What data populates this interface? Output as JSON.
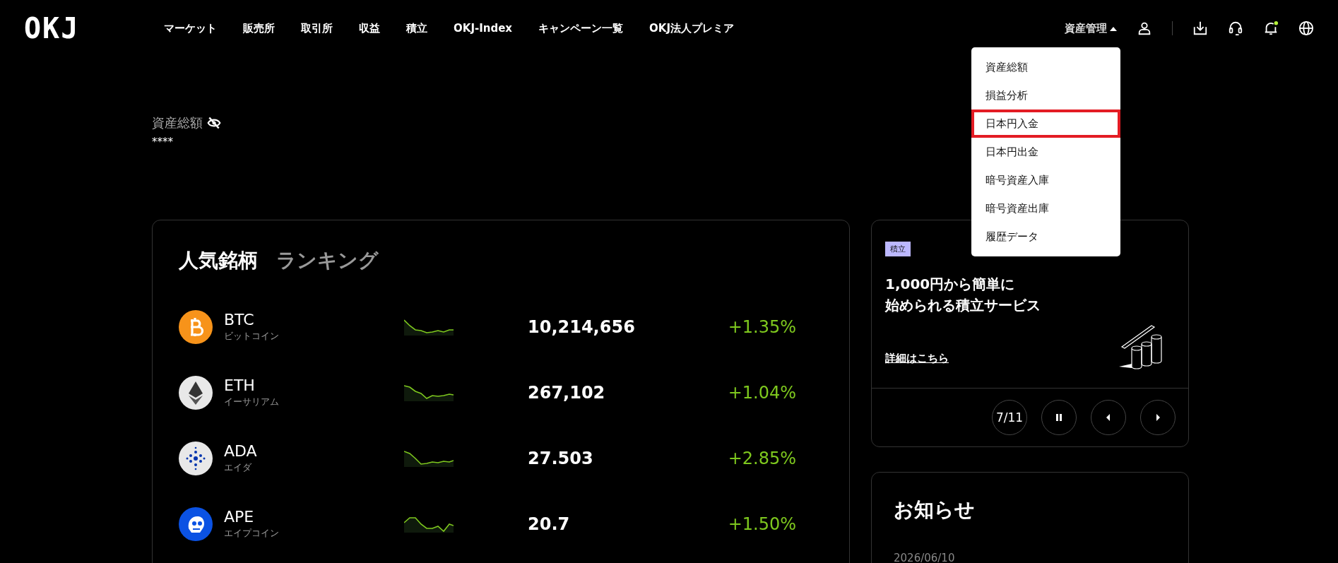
{
  "header": {
    "logo": "OKJ",
    "nav": [
      "マーケット",
      "販売所",
      "取引所",
      "収益",
      "積立",
      "OKJ-Index",
      "キャンペーン一覧",
      "OKJ法人プレミア"
    ],
    "asset_menu": {
      "label": "資産管理",
      "expanded": true,
      "items": [
        {
          "label": "資産総額",
          "selected": false
        },
        {
          "label": "損益分析",
          "selected": false
        },
        {
          "label": "日本円入金",
          "selected": true
        },
        {
          "label": "日本円出金",
          "selected": false
        },
        {
          "label": "暗号資産入庫",
          "selected": false
        },
        {
          "label": "暗号資産出庫",
          "selected": false
        },
        {
          "label": "履歴データ",
          "selected": false
        }
      ]
    },
    "notification": {
      "unread": true
    }
  },
  "assets": {
    "label": "資産総額",
    "value": "****",
    "hidden": true
  },
  "ranking_card": {
    "tabs": [
      {
        "label": "人気銘柄",
        "selected": true
      },
      {
        "label": "ランキング",
        "selected": false
      }
    ],
    "rows": [
      {
        "symbol": "BTC",
        "name": "ビットコイン",
        "price": "10,214,656",
        "change": "+1.35%"
      },
      {
        "symbol": "ETH",
        "name": "イーサリアム",
        "price": "267,102",
        "change": "+1.04%"
      },
      {
        "symbol": "ADA",
        "name": "エイダ",
        "price": "27.503",
        "change": "+2.85%"
      },
      {
        "symbol": "APE",
        "name": "エイプコイン",
        "price": "20.7",
        "change": "+1.50%"
      }
    ]
  },
  "promo": {
    "badge": "積立",
    "title_lines": [
      "1,000円から簡単に",
      "始められる積立サービス"
    ],
    "link": "詳細はこちら",
    "counter": "7/11",
    "playing": true
  },
  "news": {
    "title": "お知らせ",
    "items": [
      {
        "date": "2026/06/10"
      }
    ]
  }
}
